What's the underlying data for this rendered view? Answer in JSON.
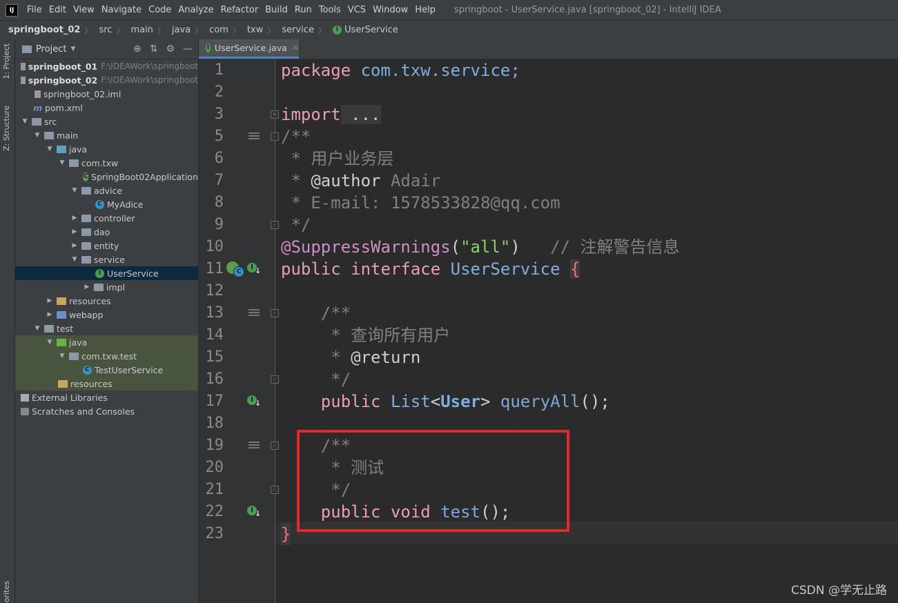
{
  "window": {
    "title": "springboot - UserService.java [springboot_02] - IntelliJ IDEA",
    "app_icon": "IJ",
    "menu": [
      "File",
      "Edit",
      "View",
      "Navigate",
      "Code",
      "Analyze",
      "Refactor",
      "Build",
      "Run",
      "Tools",
      "VCS",
      "Window",
      "Help"
    ]
  },
  "breadcrumb": [
    "springboot_02",
    "src",
    "main",
    "java",
    "com",
    "txw",
    "service",
    "UserService"
  ],
  "toolstrip": {
    "project_tab": "1: Project",
    "structure_tab": "Z: Structure",
    "favorites_tab": "orites"
  },
  "project_panel": {
    "title": "Project",
    "tree": [
      {
        "label": "springboot_01",
        "note": "F:\\IDEAWork\\springboot",
        "icon": "module-icon",
        "bold": true
      },
      {
        "label": "springboot_02",
        "note": "F:\\IDEAWork\\springboot",
        "icon": "module-icon",
        "bold": true
      },
      {
        "label": "springboot_02.iml",
        "icon": "iml-file-icon"
      },
      {
        "label": "pom.xml",
        "icon": "maven-icon"
      },
      {
        "label": "src",
        "icon": "folder-icon"
      },
      {
        "label": "main",
        "icon": "folder-icon"
      },
      {
        "label": "java",
        "icon": "source-folder-icon"
      },
      {
        "label": "com.txw",
        "icon": "package-icon"
      },
      {
        "label": "SpringBoot02Application",
        "icon": "spring-class-icon"
      },
      {
        "label": "advice",
        "icon": "package-icon"
      },
      {
        "label": "MyAdice",
        "icon": "class-icon"
      },
      {
        "label": "controller",
        "icon": "package-icon"
      },
      {
        "label": "dao",
        "icon": "package-icon"
      },
      {
        "label": "entity",
        "icon": "package-icon"
      },
      {
        "label": "service",
        "icon": "package-icon"
      },
      {
        "label": "UserService",
        "icon": "interface-icon"
      },
      {
        "label": "impl",
        "icon": "package-icon"
      },
      {
        "label": "resources",
        "icon": "resources-folder-icon"
      },
      {
        "label": "webapp",
        "icon": "web-folder-icon"
      },
      {
        "label": "test",
        "icon": "folder-icon"
      },
      {
        "label": "java",
        "icon": "test-source-folder-icon"
      },
      {
        "label": "com.txw.test",
        "icon": "package-icon"
      },
      {
        "label": "TestUserService",
        "icon": "class-icon"
      },
      {
        "label": "resources",
        "icon": "test-resources-folder-icon"
      },
      {
        "label": "External Libraries",
        "icon": "libraries-icon"
      },
      {
        "label": "Scratches and Consoles",
        "icon": "scratches-icon"
      }
    ]
  },
  "editor": {
    "tab": {
      "label": "UserService.java",
      "icon": "interface-icon"
    },
    "line_numbers": [
      "1",
      "2",
      "3",
      "5",
      "6",
      "7",
      "8",
      "9",
      "10",
      "11",
      "12",
      "13",
      "14",
      "15",
      "16",
      "17",
      "18",
      "19",
      "20",
      "21",
      "22",
      "23"
    ],
    "code": {
      "l1_kw": "package",
      "l1_rest": " com.txw.service;",
      "l3_kw": "import",
      "l3_rest": " ...",
      "l5": "/**",
      "l6": " * 用户业务层",
      "l7_star": " * ",
      "l7_tag": "@author",
      "l7_rest": " Adair",
      "l8": " * E-mail: 1578533828@qq.com",
      "l9": " */",
      "l10_ann": "@SuppressWarnings",
      "l10_p1": "(",
      "l10_str": "\"all\"",
      "l10_p2": ")",
      "l10_cm": "   // 注解警告信息",
      "l11_kw": "public interface",
      "l11_cls": " UserService ",
      "l11_br": "{",
      "l13": "    /**",
      "l14": "     * 查询所有用户",
      "l15_star": "     * ",
      "l15_tag": "@return",
      "l16": "     */",
      "l17_kw": "    public",
      "l17_t": " List",
      "l17_lt": "<",
      "l17_u": "User",
      "l17_gt": ">",
      "l17_fn": " queryAll",
      "l17_end": "();",
      "l19": "    /**",
      "l20": "     * 测试",
      "l21": "     */",
      "l22_kw": "    public void",
      "l22_fn": " test",
      "l22_end": "();",
      "l23": "}"
    }
  },
  "watermark": "CSDN @学无止路",
  "colors": {
    "highlight_box": "#e4292d",
    "keyword": "#e8a0b0",
    "class": "#7dafe0"
  }
}
